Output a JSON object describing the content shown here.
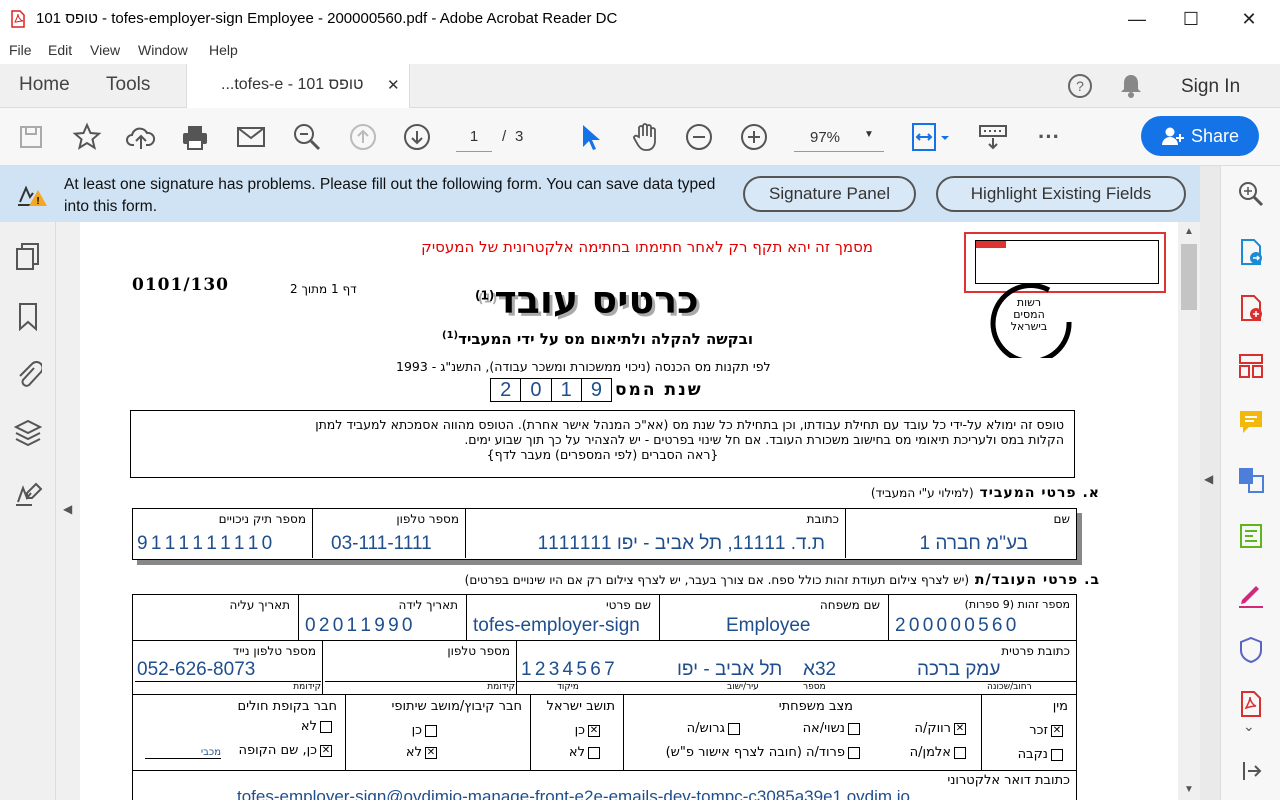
{
  "window": {
    "title": "טופס 101 - tofes-employer-sign Employee - 200000560.pdf - Adobe Acrobat Reader DC",
    "min": "—",
    "max": "☐",
    "close": "✕"
  },
  "menu": [
    "File",
    "Edit",
    "View",
    "Window",
    "Help"
  ],
  "tabs": {
    "home": "Home",
    "tools": "Tools",
    "doc": "...tofes-e - 101 טופס",
    "close": "✕",
    "signin": "Sign In"
  },
  "toolbar": {
    "page_current": "1",
    "page_sep": "/",
    "page_total": "3",
    "zoom": "97%",
    "share": "Share"
  },
  "banner": {
    "message": "At least one signature has problems.  Please fill out the following form. You can save data typed into this form.",
    "signature_panel": "Signature Panel",
    "highlight_fields": "Highlight Existing Fields"
  },
  "doc": {
    "notice": "מסמך זה יהא תקף רק לאחר חתימתו בחתימה אלקטרונית של המעסיק",
    "form_code": "0101/130",
    "page_of": "דף 1 מתוך 2",
    "title": "כרטיס עובד",
    "title_sup": "(1)",
    "subtitle": "ובקשה להקלה ולתיאום מס על ידי המעביד",
    "subtitle_sup": "(1)",
    "regulation": "לפי תקנות מס הכנסה (ניכוי ממשכורת ומשכר עבודה), התשנ\"ג - 1993",
    "tax_year_label": "שנת המס",
    "tax_year_digits": [
      "2",
      "0",
      "1",
      "9"
    ],
    "logo_text": "רשות המסים בישראל",
    "instructions_1": "טופס זה ימולא על-ידי כל עובד עם תחילת עבודתו, וכן בתחילת כל שנת מס (אא\"כ המנהל אישר אחרת). הטופס מהווה אסמכתא למעביד למתן",
    "instructions_2": "הקלות במס ולעריכת תיאומי מס בחישוב משכורת העובד. אם חל שינוי בפרטים - יש להצהיר על כך תוך שבוע ימים.",
    "instructions_3": "{ראה הסברים (לפי המספרים) מעבר לדף}",
    "section_a": "א. פרטי המעביד",
    "section_a_note": "(למילוי ע\"י המעביד)",
    "employer": {
      "name_label": "שם",
      "name": "בע\"מ חברה 1",
      "address_label": "כתובת",
      "address": "ת.ד. 11111, תל אביב - יפו 1111111",
      "phone_label": "מספר טלפון",
      "phone": "03-111-1111",
      "file_label": "מספר תיק ניכויים",
      "file": "9 1 1 1 1 1 1 1 1 0"
    },
    "section_b": "ב. פרטי העובד/ת",
    "section_b_note": "(יש לצרף צילום תעודת זהות כולל ספח. אם צורך בעבר, יש לצרף צילום רק אם היו שינויים בפרטים)",
    "employee": {
      "id_label": "מספר זהות (9 ספרות)",
      "id": "2 0 0 0 0 0 5 6 0",
      "last_label": "שם משפחה",
      "last": "Employee",
      "first_label": "שם פרטי",
      "first": "tofes-employer-sign",
      "birth_label": "תאריך לידה",
      "birth": "0 2 0 1 1 9 9 0",
      "aliya_label": "תאריך עליה",
      "address_label": "כתובת פרטית",
      "street": "עמק ברכה",
      "house": "32א",
      "city": "תל אביב - יפו",
      "zip": "1 2 3 4 5 6 7",
      "street_sub": "רחוב/שכונה",
      "house_sub": "מספר",
      "city_sub": "עיר/ישוב",
      "zip_sub": "מיקוד",
      "phone_label": "מספר טלפון",
      "phone_sub": "קידומת",
      "mobile_label": "מספר טלפון נייד",
      "mobile": "052-626-8073",
      "mobile_sub": "קידומת",
      "gender_label": "מין",
      "male": "זכר",
      "female": "נקבה",
      "marital_label": "מצב משפחתי",
      "single": "רווק/ה",
      "married": "נשוי/אה",
      "divorced": "גרוש/ה",
      "widowed": "אלמן/ה",
      "separated": "פרוד/ה (חובה לצרף אישור פ\"ש)",
      "resident_label": "תושב ישראל",
      "yes": "כן",
      "no": "לא",
      "kibbutz_label": "חבר קיבוץ/מושב שיתופי",
      "hmo_label": "חבר בקופת חולים",
      "hmo_yes": "כן, שם הקופה",
      "hmo_name": "מכבי",
      "email_label": "כתובת דואר אלקטרוני",
      "email": "tofes-employer-sign@ovdimio-manage-front-e2e-emails-dev-tompc-c3085a39e1.ovdim.io"
    }
  },
  "colors": {
    "accent": "#1473e6",
    "banner": "#cfe3f5",
    "notice": "#e00000",
    "value": "#1f4e8c"
  }
}
